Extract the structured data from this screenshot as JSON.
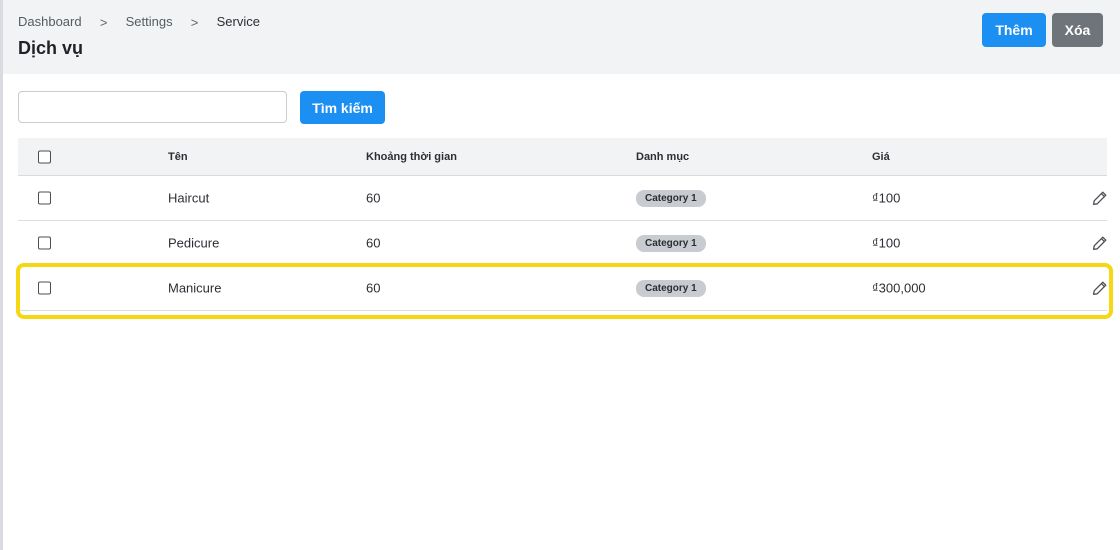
{
  "breadcrumb": {
    "items": [
      "Dashboard",
      "Settings",
      "Service"
    ],
    "separator": ">"
  },
  "page": {
    "title": "Dịch vụ"
  },
  "toolbar": {
    "add_label": "Thêm",
    "delete_label": "Xóa"
  },
  "search": {
    "placeholder": "",
    "value": "",
    "button_label": "Tìm kiếm"
  },
  "table": {
    "columns": [
      "Tên",
      "Khoảng thời gian",
      "Danh mục",
      "Giá"
    ],
    "rows": [
      {
        "name": "Haircut",
        "duration": "60",
        "category": "Category 1",
        "price": "₫100"
      },
      {
        "name": "Pedicure",
        "duration": "60",
        "category": "Category 1",
        "price": "₫100"
      },
      {
        "name": "Manicure",
        "duration": "60",
        "category": "Category 1",
        "price": "₫300,000"
      }
    ]
  },
  "colors": {
    "primary": "#1b8ff2",
    "secondary": "#6f747b",
    "highlight": "#f6d714"
  },
  "icons": {
    "edit": "pencil-icon",
    "breadcrumb_separator": "chevron-right-icon"
  }
}
